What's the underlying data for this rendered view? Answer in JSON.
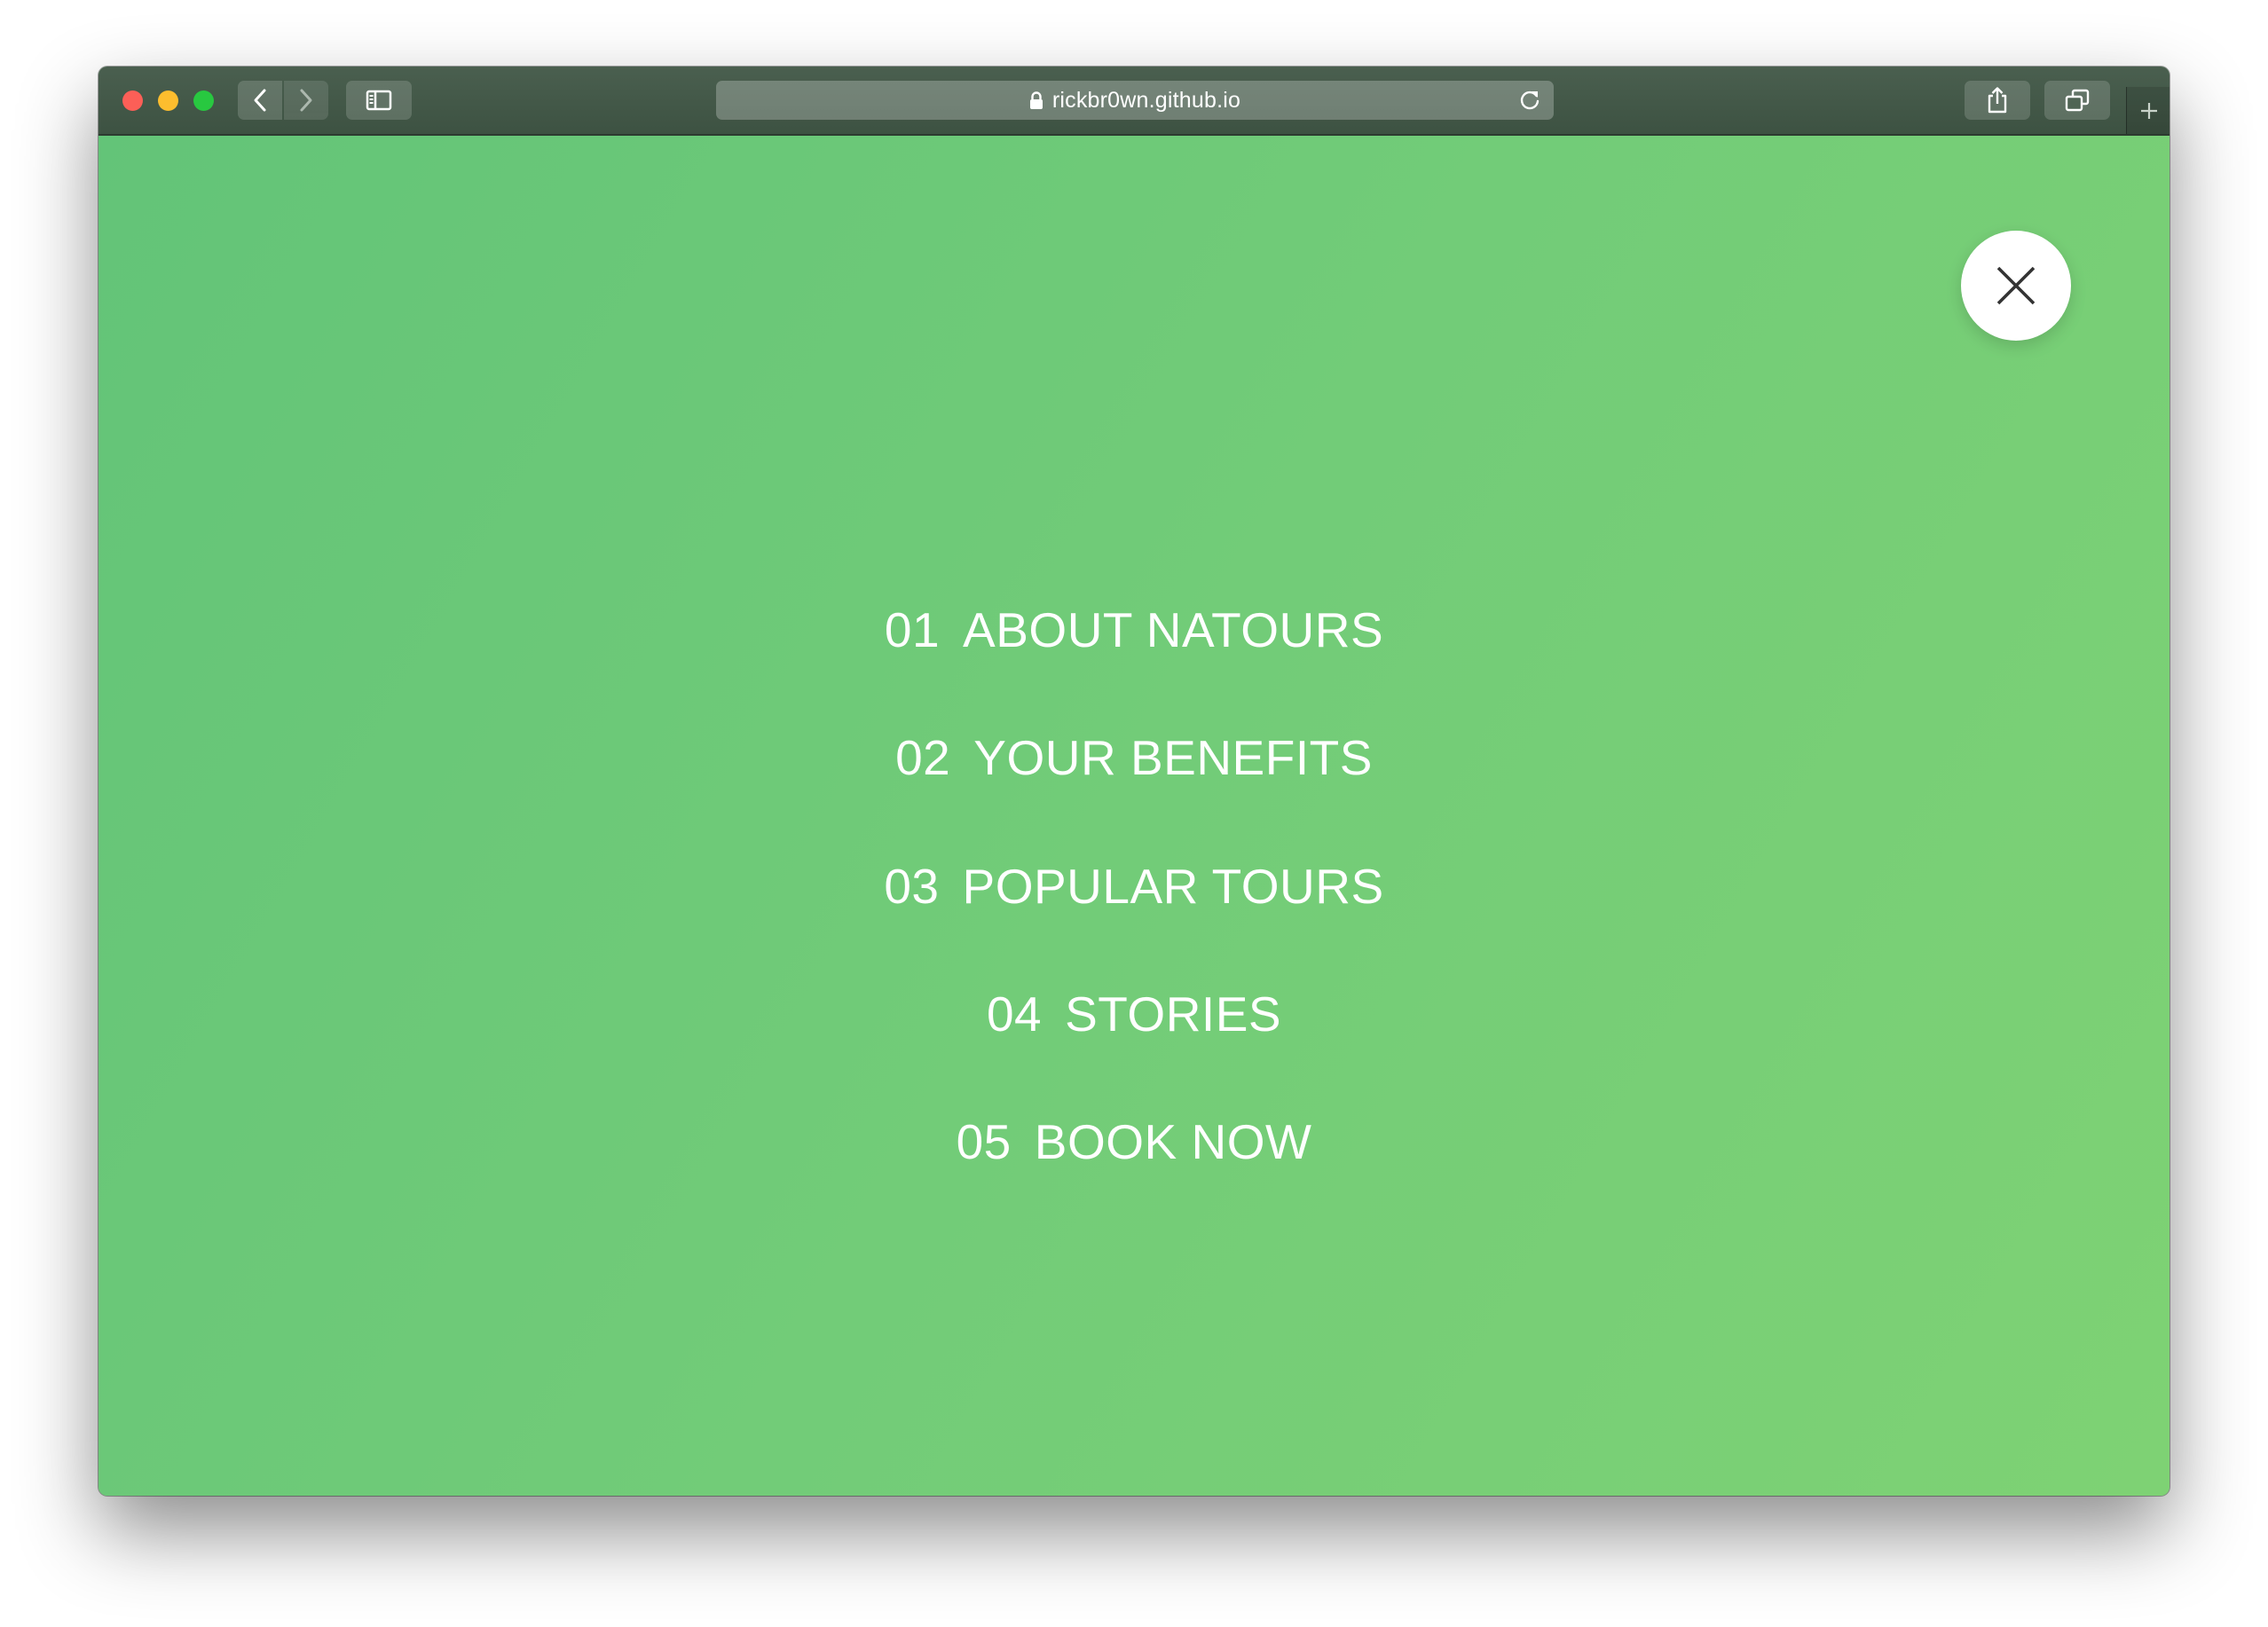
{
  "browser": {
    "url": "rickbr0wn.github.io",
    "icons": {
      "back": "chevron-left-icon",
      "forward": "chevron-right-icon",
      "sidebar": "sidebar-icon",
      "lock": "lock-icon",
      "reload": "reload-icon",
      "share": "share-icon",
      "tabs": "tabs-icon",
      "new_tab": "plus-icon"
    }
  },
  "page": {
    "background_colors": [
      "#63c478",
      "#7ed274"
    ],
    "close_icon": "close-icon",
    "nav": [
      {
        "number": "01",
        "label": "ABOUT NATOURS"
      },
      {
        "number": "02",
        "label": "YOUR BENEFITS"
      },
      {
        "number": "03",
        "label": "POPULAR TOURS"
      },
      {
        "number": "04",
        "label": "STORIES"
      },
      {
        "number": "05",
        "label": "BOOK NOW"
      }
    ]
  }
}
